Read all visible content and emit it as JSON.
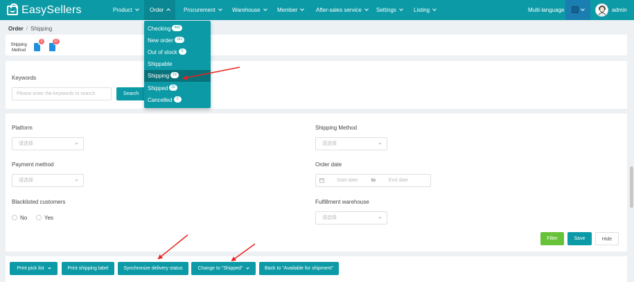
{
  "app": {
    "name": "EasySellers"
  },
  "nav": [
    {
      "label": "Product",
      "open": false
    },
    {
      "label": "Order",
      "open": true
    },
    {
      "label": "Procurement",
      "open": false
    },
    {
      "label": "Warehouse",
      "open": false
    },
    {
      "label": "Member",
      "open": false
    },
    {
      "label": "After-sales service",
      "open": false
    },
    {
      "label": "Settings",
      "open": false
    },
    {
      "label": "Listing",
      "open": false
    }
  ],
  "header": {
    "language": "Multi-language",
    "theme_color": "#1a7fb0",
    "user": "admin"
  },
  "breadcrumb": {
    "root": "Order",
    "separator": "/",
    "current": "Shipping"
  },
  "status": {
    "label_line1": "Shipping",
    "label_line2": "Method",
    "badges": [
      "2",
      "17"
    ]
  },
  "order_menu": [
    {
      "label": "Checking",
      "count": "442"
    },
    {
      "label": "New order",
      "count": "161"
    },
    {
      "label": "Out of stock",
      "count": "5"
    },
    {
      "label": "Shippable",
      "count": ""
    },
    {
      "label": "Shipping",
      "count": "19",
      "active": true
    },
    {
      "label": "Shipped",
      "count": "22"
    },
    {
      "label": "Cancelled",
      "count": "2"
    }
  ],
  "search": {
    "label": "Keywords",
    "placeholder": "Please enter the keywords to search",
    "button": "Search"
  },
  "filters": {
    "platform": {
      "label": "Platform",
      "placeholder": "请选择"
    },
    "shipping_method": {
      "label": "Shipping Method",
      "placeholder": "请选择"
    },
    "payment_method": {
      "label": "Payment method",
      "placeholder": "请选择"
    },
    "order_date": {
      "label": "Order date",
      "start": "Start date",
      "to": "to",
      "end": "End date"
    },
    "blacklisted": {
      "label": "Blacklisted customers",
      "no": "No",
      "yes": "Yes"
    },
    "fulfillment_warehouse": {
      "label": "Fulfillment warehouse",
      "placeholder": "请选择"
    },
    "buttons": {
      "filter": "Filter",
      "save": "Save",
      "hide": "Hide"
    }
  },
  "actions": {
    "print_pick_list": "Print pick list",
    "print_shipping_label": "Print shipping label",
    "sync_delivery": "Synchronize delivery status",
    "change_shipped": "Change to \"Shipped\"",
    "back_available": "Back to \"Available for shipment\""
  },
  "colors": {
    "primary": "#0c9aa6",
    "filter_green": "#67c23a",
    "badge_red": "#f56c6c",
    "annotation_red": "#e8231f"
  }
}
